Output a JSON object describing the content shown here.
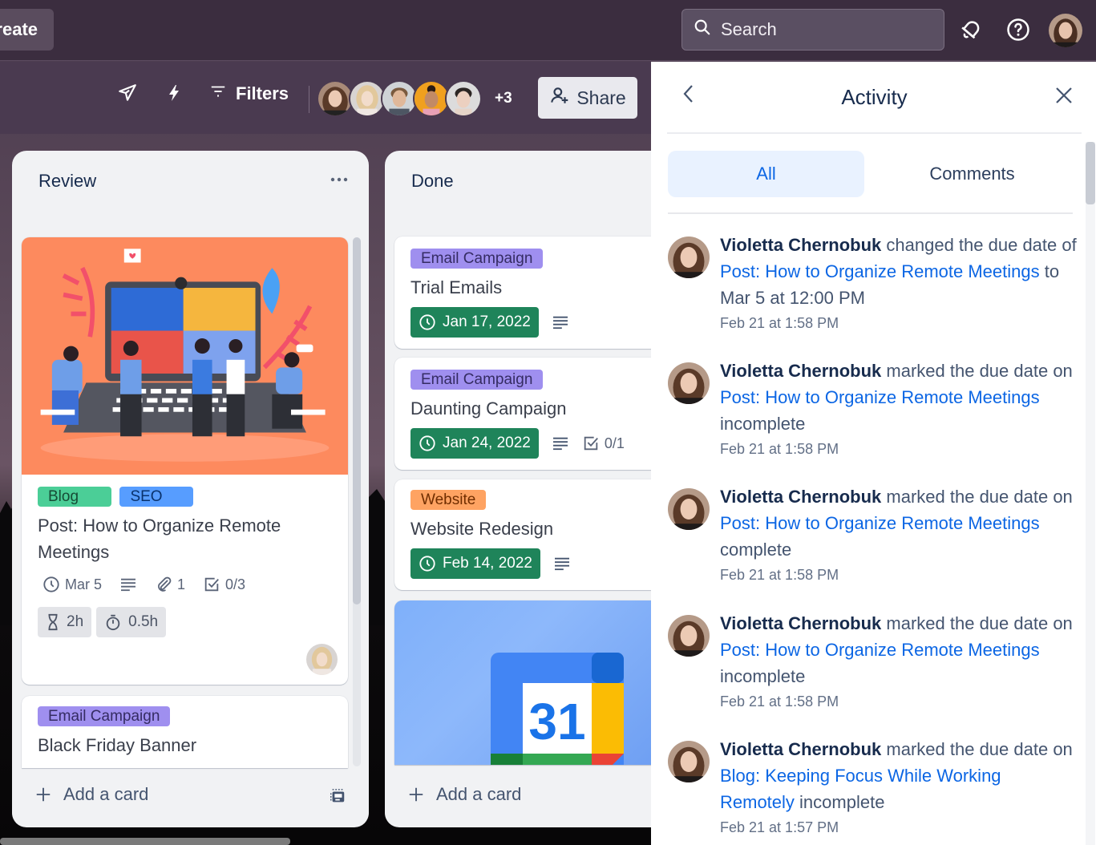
{
  "topnav": {
    "create_label": "reate",
    "search_placeholder": "Search",
    "icons": [
      "notifications-bell-icon",
      "help-icon",
      "profile-avatar"
    ]
  },
  "boardbar": {
    "icons": [
      "power-ups-rocket-icon",
      "automation-lightning-icon",
      "filter-icon"
    ],
    "filters_label": "Filters",
    "members": [
      "Violetta Chernobuk",
      "member-2",
      "member-3",
      "member-4",
      "member-5"
    ],
    "more_members": "+3",
    "share_label": "Share"
  },
  "lists": [
    {
      "title": "Review",
      "menu": "···",
      "cards": [
        {
          "cover": "remote-meeting-illustration",
          "labels": [
            {
              "text": "Blog",
              "color": "#4bce97"
            },
            {
              "text": "SEO",
              "color": "#579dff"
            }
          ],
          "title": "Post: How to Organize Remote Meetings",
          "due": "Mar 5",
          "attachments": "1",
          "checklist": "0/3",
          "estimate": "2h",
          "spent": "0.5h"
        },
        {
          "labels": [
            {
              "text": "Email Campaign",
              "color": "#9f8fef"
            }
          ],
          "title": "Black Friday Banner"
        }
      ],
      "add_card_label": "Add a card"
    },
    {
      "title": "Done",
      "cards": [
        {
          "labels": [
            {
              "text": "Email Campaign",
              "color": "#9f8fef"
            }
          ],
          "title": "Trial Emails",
          "due": "Jan 17, 2022"
        },
        {
          "labels": [
            {
              "text": "Email Campaign",
              "color": "#9f8fef"
            }
          ],
          "title": "Daunting Campaign",
          "due": "Jan 24, 2022",
          "checklist": "0/1"
        },
        {
          "labels": [
            {
              "text": "Website",
              "color": "#fea362"
            }
          ],
          "title": "Website Redesign",
          "due": "Feb 14, 2022"
        },
        {
          "cover": "google-calendar-31",
          "cover_text": "31"
        }
      ],
      "add_card_label": "Add a card"
    }
  ],
  "activity": {
    "title": "Activity",
    "tabs": [
      {
        "label": "All",
        "active": true
      },
      {
        "label": "Comments",
        "active": false
      }
    ],
    "items": [
      {
        "user": "Violetta Chernobuk",
        "action": " changed the due date of ",
        "card": "Post: How to Organize Remote Meetings",
        "suffix": " to Mar 5 at 12:00 PM",
        "time": "Feb 21 at 1:58 PM"
      },
      {
        "user": "Violetta Chernobuk",
        "action": " marked the due date on ",
        "card": "Post: How to Organize Remote Meetings",
        "suffix": " incomplete",
        "time": "Feb 21 at 1:58 PM"
      },
      {
        "user": "Violetta Chernobuk",
        "action": " marked the due date on ",
        "card": "Post: How to Organize Remote Meetings",
        "suffix": " complete",
        "time": "Feb 21 at 1:58 PM"
      },
      {
        "user": "Violetta Chernobuk",
        "action": " marked the due date on ",
        "card": "Post: How to Organize Remote Meetings",
        "suffix": " incomplete",
        "time": "Feb 21 at 1:58 PM"
      },
      {
        "user": "Violetta Chernobuk",
        "action": " marked the due date on ",
        "card": "Blog: Keeping Focus While Working Remotely",
        "suffix": " incomplete",
        "time": "Feb 21 at 1:57 PM"
      }
    ]
  },
  "colors": {
    "nav_bg": "#3b2d3f",
    "due_complete": "#1f845a",
    "link": "#0c66e4",
    "tab_active_bg": "#e9f2ff"
  }
}
